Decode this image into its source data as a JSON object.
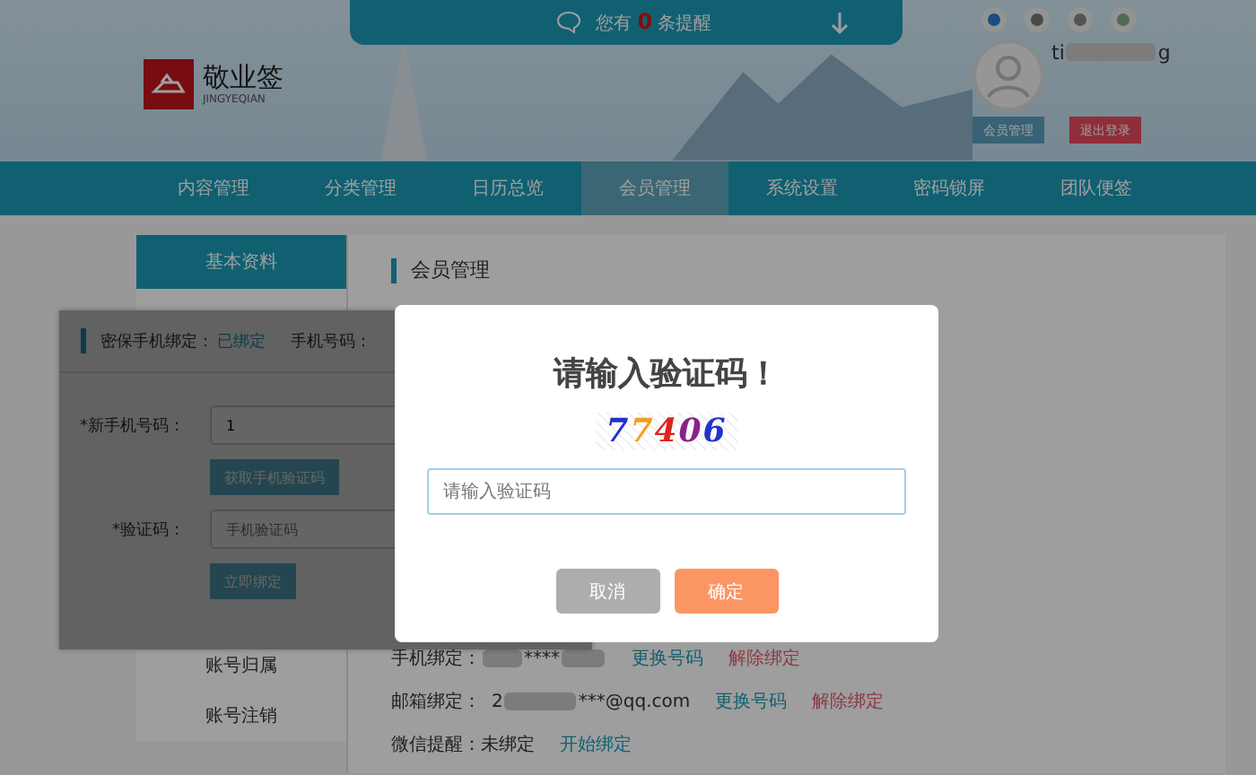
{
  "notice": {
    "prefix": "您有",
    "count": "0",
    "suffix": "条提醒"
  },
  "logo": {
    "name": "敬业签",
    "pinyin": "JINGYEQIAN"
  },
  "user": {
    "name_start": "ti",
    "name_end": "g",
    "buttons": [
      {
        "label": "会员管理",
        "kind": "plain"
      },
      {
        "label": "退出登录",
        "kind": "danger"
      }
    ]
  },
  "nav": [
    {
      "label": "内容管理",
      "selected": false
    },
    {
      "label": "分类管理",
      "selected": false
    },
    {
      "label": "日历总览",
      "selected": false
    },
    {
      "label": "会员管理",
      "selected": true
    },
    {
      "label": "系统设置",
      "selected": false
    },
    {
      "label": "密码锁屏",
      "selected": false
    },
    {
      "label": "团队便签",
      "selected": false
    }
  ],
  "sidebar": {
    "top": [
      {
        "label": "基本资料",
        "selected": true
      }
    ],
    "bottom": [
      {
        "label": "账号归属",
        "selected": false
      },
      {
        "label": "账号注销",
        "selected": false
      }
    ]
  },
  "main": {
    "title": "会员管理",
    "rows": [
      {
        "label": "手机绑定：",
        "value_start": "",
        "value_mid": "****",
        "value_end": "",
        "actions": [
          {
            "label": "更换号码",
            "kind": "link"
          },
          {
            "label": "解除绑定",
            "kind": "danger"
          }
        ]
      },
      {
        "label": "邮箱绑定：",
        "value_start": "2",
        "value_mid": "",
        "value_end": "***@qq.com",
        "actions": [
          {
            "label": "更换号码",
            "kind": "link"
          },
          {
            "label": "解除绑定",
            "kind": "danger"
          }
        ]
      },
      {
        "label": "微信提醒：",
        "value_start": "",
        "value_mid": "",
        "value_end": "未绑定",
        "actions": [
          {
            "label": "开始绑定",
            "kind": "link"
          }
        ]
      }
    ]
  },
  "phone_panel": {
    "status_label": "密保手机绑定：",
    "status": "已绑定",
    "number_label": "手机号码：",
    "new_label": "*新手机号码：",
    "new_value": "1",
    "get_code": "获取手机验证码",
    "code_label": "*验证码：",
    "code_placeholder": "手机验证码",
    "bind": "立即绑定"
  },
  "modal": {
    "title": "请输入验证码！",
    "captcha": "77406",
    "placeholder": "请输入验证码",
    "buttons": [
      {
        "label": "取消",
        "kind": "cancel"
      },
      {
        "label": "确定",
        "kind": "confirm"
      }
    ]
  }
}
